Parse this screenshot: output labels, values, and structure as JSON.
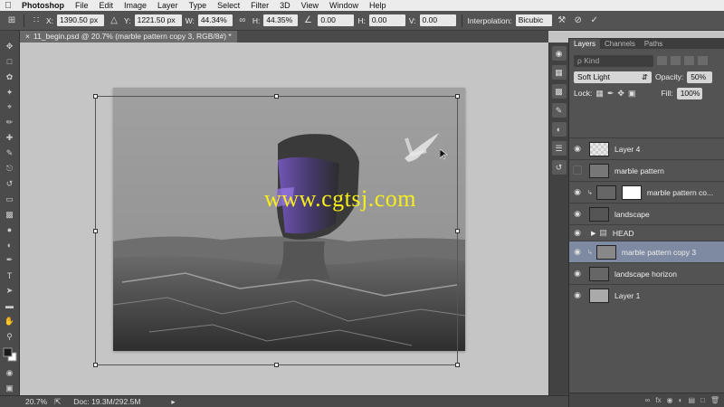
{
  "menubar": {
    "apple": "",
    "items": [
      "Photoshop",
      "File",
      "Edit",
      "Image",
      "Layer",
      "Type",
      "Select",
      "Filter",
      "3D",
      "View",
      "Window",
      "Help"
    ]
  },
  "options": {
    "x_label": "X:",
    "x_value": "1390.50 px",
    "y_label": "Y:",
    "y_value": "1221.50 px",
    "w_label": "W:",
    "w_value": "44.34%",
    "h_label": "H:",
    "h_value": "44.35%",
    "angle_value": "0.00",
    "hskew_label": "H:",
    "hskew_value": "0.00",
    "vskew_label": "V:",
    "vskew_value": "0.00",
    "interp_label": "Interpolation:",
    "interp_value": "Bicubic"
  },
  "document": {
    "tab_label": "11_begin.psd @ 20.7% (marble pattern copy 3, RGB/8#) *",
    "watermark": "www.cgtsj.com"
  },
  "status": {
    "zoom": "20.7%",
    "doc": "Doc: 19.3M/292.5M"
  },
  "panel": {
    "tabs": [
      "Layers",
      "Channels",
      "Paths"
    ],
    "kind_placeholder": "ρ Kind",
    "blend_mode": "Soft Light",
    "opacity_label": "Opacity:",
    "opacity_value": "50%",
    "lock_label": "Lock:",
    "fill_label": "Fill:",
    "fill_value": "100%",
    "layers": [
      {
        "name": "Layer 4",
        "visible": true,
        "selected": false,
        "type": "pixel",
        "thumb": "#e8e8e8"
      },
      {
        "name": "marble pattern",
        "visible": false,
        "selected": false,
        "type": "pixel",
        "thumb": "#777"
      },
      {
        "name": "marble pattern co...",
        "visible": true,
        "selected": false,
        "type": "masked",
        "thumb": "#666"
      },
      {
        "name": "landscape",
        "visible": true,
        "selected": false,
        "type": "pixel",
        "thumb": "#555"
      },
      {
        "name": "HEAD",
        "visible": true,
        "selected": false,
        "type": "group",
        "thumb": ""
      },
      {
        "name": "marble pattern copy 3",
        "visible": true,
        "selected": true,
        "type": "clipped",
        "thumb": "#888"
      },
      {
        "name": "landscape horizon",
        "visible": true,
        "selected": false,
        "type": "pixel",
        "thumb": "#666"
      },
      {
        "name": "Layer 1",
        "visible": true,
        "selected": false,
        "type": "pixel",
        "thumb": "#aaa"
      }
    ]
  }
}
